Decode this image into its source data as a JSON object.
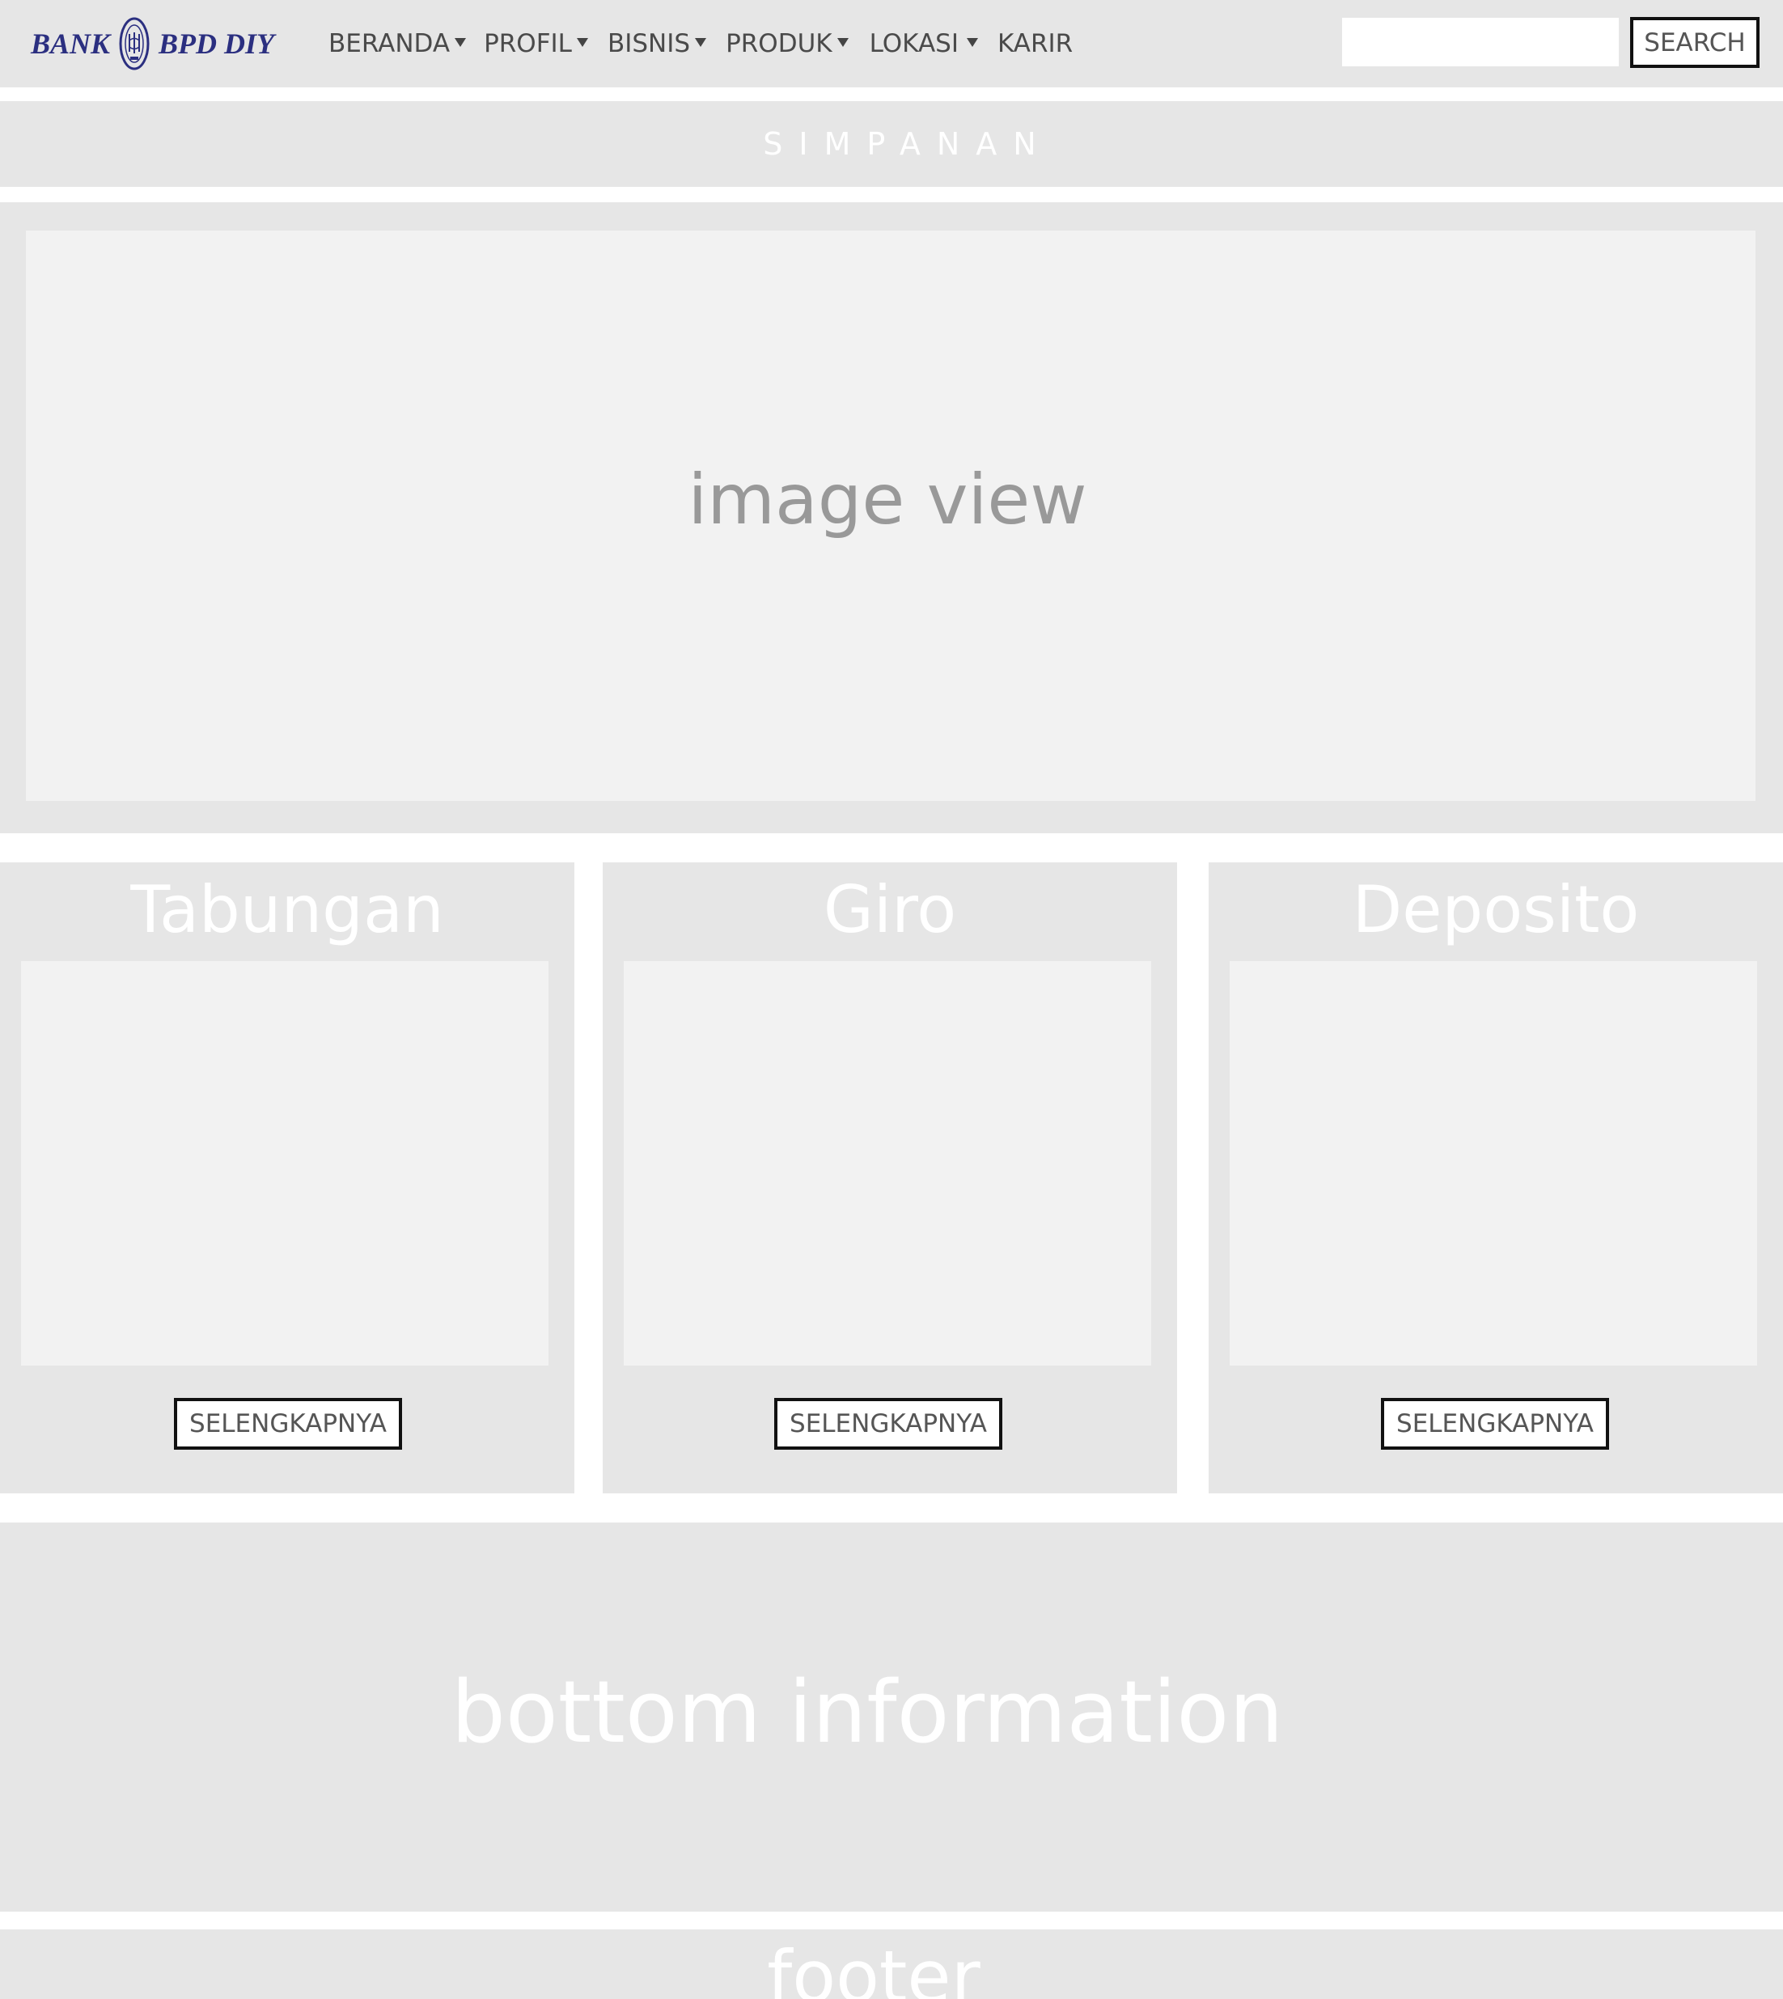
{
  "brand": {
    "left_text": "BANK",
    "right_text": "BPD DIY",
    "color": "#2b2f80"
  },
  "nav": {
    "items": [
      {
        "label": "BERANDA",
        "has_dropdown": true
      },
      {
        "label": "PROFIL",
        "has_dropdown": true
      },
      {
        "label": "BISNIS",
        "has_dropdown": true
      },
      {
        "label": "PRODUK",
        "has_dropdown": true
      },
      {
        "label": "LOKASI",
        "has_dropdown": true
      },
      {
        "label": "KARIR",
        "has_dropdown": false
      }
    ]
  },
  "search": {
    "value": "",
    "button_label": "SEARCH"
  },
  "page_title": "SIMPANAN",
  "hero": {
    "placeholder_text": "image view"
  },
  "cards": [
    {
      "title": "Tabungan",
      "button_label": "SELENGKAPNYA"
    },
    {
      "title": "Giro",
      "button_label": "SELENGKAPNYA"
    },
    {
      "title": "Deposito",
      "button_label": "SELENGKAPNYA"
    }
  ],
  "bottom_info": {
    "text": "bottom information"
  },
  "footer": {
    "text": "footer"
  },
  "colors": {
    "panel_bg": "#e6e6e6",
    "placeholder_bg": "#f2f2f2",
    "page_bg": "#ffffff"
  }
}
